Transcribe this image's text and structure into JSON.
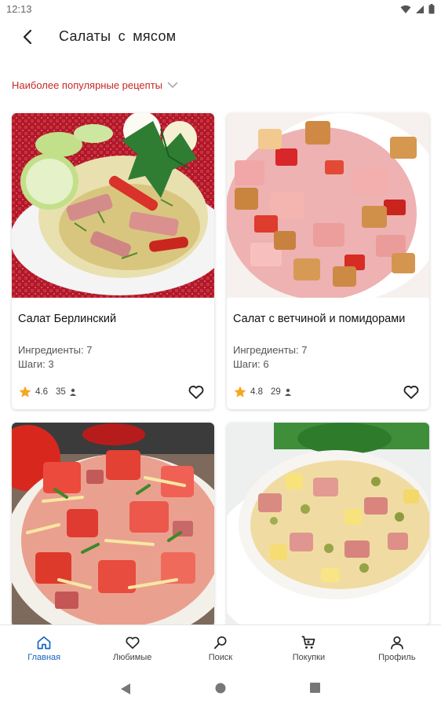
{
  "status": {
    "time": "12:13"
  },
  "header": {
    "title": "Салаты с мясом"
  },
  "sort": {
    "label": "Наиболее популярные рецепты"
  },
  "cards": [
    {
      "title": "Салат Берлинский",
      "ingredients": "Ингредиенты: 7",
      "steps": "Шаги: 3",
      "rating": "4.6",
      "votes": "35"
    },
    {
      "title": "Салат с ветчиной и помидорами",
      "ingredients": "Ингредиенты: 7",
      "steps": "Шаги: 6",
      "rating": "4.8",
      "votes": "29"
    },
    {
      "title": "",
      "ingredients": "",
      "steps": "",
      "rating": "",
      "votes": ""
    },
    {
      "title": "",
      "ingredients": "",
      "steps": "",
      "rating": "",
      "votes": ""
    }
  ],
  "nav": {
    "home": "Главная",
    "favorites": "Любимые",
    "search": "Поиск",
    "shopping": "Покупки",
    "profile": "Профиль"
  },
  "colors": {
    "accent_red": "#c62828",
    "active_blue": "#1565c0",
    "star": "#f5a623"
  }
}
